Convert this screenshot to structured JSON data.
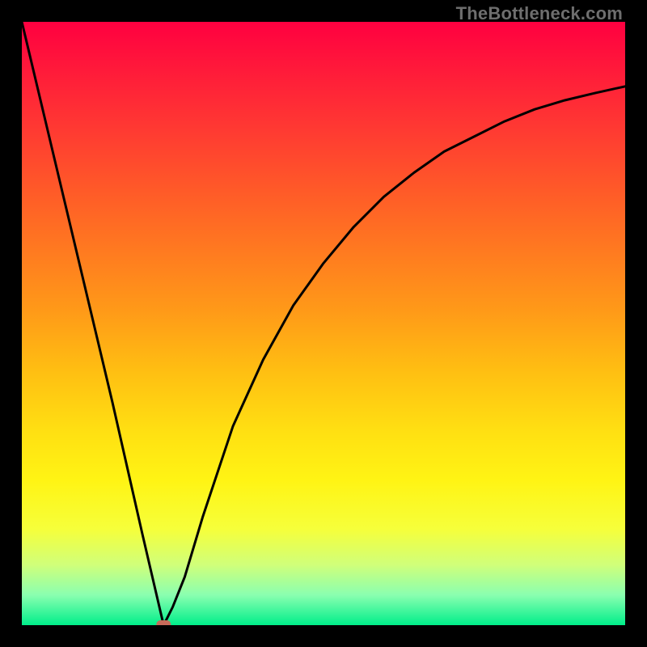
{
  "attribution": "TheBottleneck.com",
  "chart_data": {
    "type": "line",
    "title": "",
    "xlabel": "",
    "ylabel": "",
    "xlim": [
      0,
      100
    ],
    "ylim": [
      0,
      100
    ],
    "grid": false,
    "background": "red-yellow-green vertical gradient",
    "series": [
      {
        "name": "bottleneck-curve",
        "x": [
          0,
          5,
          10,
          15,
          20,
          23.5,
          25,
          27,
          30,
          35,
          40,
          45,
          50,
          55,
          60,
          65,
          70,
          75,
          80,
          85,
          90,
          95,
          100
        ],
        "y": [
          100,
          79,
          58,
          37,
          15,
          0,
          3,
          8,
          18,
          33,
          44,
          53,
          60,
          66,
          71,
          75,
          78.5,
          81,
          83.5,
          85.5,
          87,
          88.2,
          89.3
        ]
      }
    ],
    "marker": {
      "name": "minimum-point",
      "x": 23.5,
      "y": 0,
      "color": "#c76b5a",
      "shape": "rounded-horizontal-pill"
    }
  }
}
